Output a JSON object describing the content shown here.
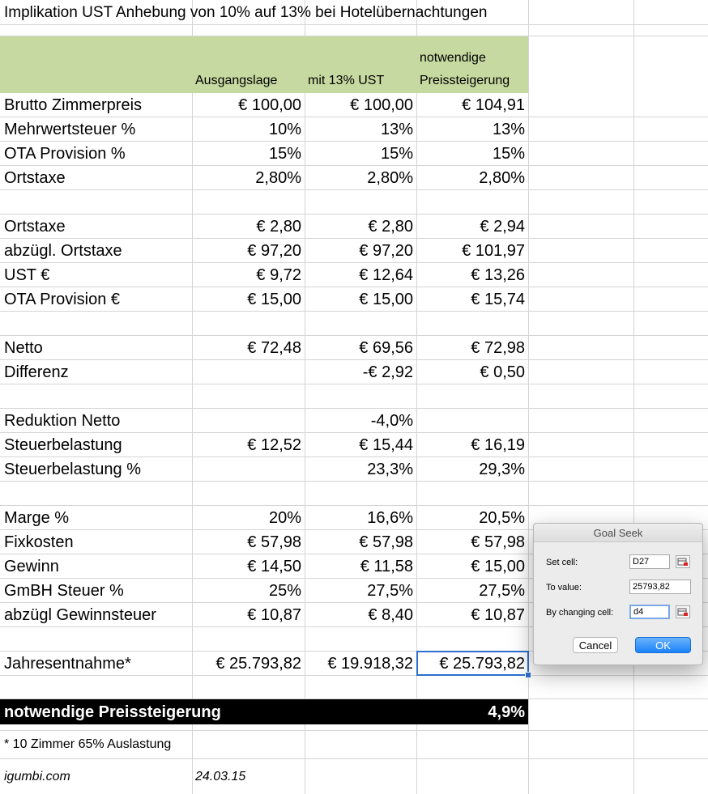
{
  "sheet": {
    "title": "Implikation UST Anhebung von 10% auf 13% bei Hotelübernachtungen",
    "headers": {
      "col_b": "Ausgangslage",
      "col_c": "mit 13% UST",
      "col_d_line1": "notwendige",
      "col_d_line2": "Preissteigerung"
    },
    "rows": [
      {
        "label": "Brutto Zimmerpreis",
        "b": "€ 100,00",
        "c": "€ 100,00",
        "d": "€ 104,91"
      },
      {
        "label": "Mehrwertsteuer %",
        "b": "10%",
        "c": "13%",
        "d": "13%"
      },
      {
        "label": "OTA Provision %",
        "b": "15%",
        "c": "15%",
        "d": "15%"
      },
      {
        "label": "Ortstaxe",
        "b": "2,80%",
        "c": "2,80%",
        "d": "2,80%"
      },
      {
        "label": "",
        "b": "",
        "c": "",
        "d": ""
      },
      {
        "label": "Ortstaxe",
        "b": "€ 2,80",
        "c": "€ 2,80",
        "d": "€ 2,94"
      },
      {
        "label": "abzügl. Ortstaxe",
        "b": "€ 97,20",
        "c": "€ 97,20",
        "d": "€ 101,97"
      },
      {
        "label": "UST €",
        "b": "€ 9,72",
        "c": "€ 12,64",
        "d": "€ 13,26"
      },
      {
        "label": "OTA Provision €",
        "b": "€ 15,00",
        "c": "€ 15,00",
        "d": "€ 15,74"
      },
      {
        "label": "",
        "b": "",
        "c": "",
        "d": ""
      },
      {
        "label": "Netto",
        "b": "€ 72,48",
        "c": "€ 69,56",
        "d": "€ 72,98"
      },
      {
        "label": "Differenz",
        "b": "",
        "c": "-€ 2,92",
        "d": "€ 0,50"
      },
      {
        "label": "",
        "b": "",
        "c": "",
        "d": ""
      },
      {
        "label": "Reduktion Netto",
        "b": "",
        "c": "-4,0%",
        "d": ""
      },
      {
        "label": "Steuerbelastung",
        "b": "€ 12,52",
        "c": "€ 15,44",
        "d": "€ 16,19"
      },
      {
        "label": "Steuerbelastung %",
        "b": "",
        "c": "23,3%",
        "d": "29,3%"
      },
      {
        "label": "",
        "b": "",
        "c": "",
        "d": ""
      },
      {
        "label": "Marge %",
        "b": "20%",
        "c": "16,6%",
        "d": "20,5%"
      },
      {
        "label": "Fixkosten",
        "b": "€ 57,98",
        "c": "€ 57,98",
        "d": "€ 57,98"
      },
      {
        "label": "Gewinn",
        "b": "€ 14,50",
        "c": "€ 11,58",
        "d": "€ 15,00"
      },
      {
        "label": "GmBH Steuer %",
        "b": "25%",
        "c": "27,5%",
        "d": "27,5%"
      },
      {
        "label": "abzügl Gewinnsteuer",
        "b": "€ 10,87",
        "c": "€ 8,40",
        "d": "€ 10,87"
      },
      {
        "label": "",
        "b": "",
        "c": "",
        "d": ""
      }
    ],
    "jahres": {
      "label": "Jahresentnahme*",
      "b": "€ 25.793,82",
      "c": "€ 19.918,32",
      "d": "€ 25.793,82"
    },
    "summary": {
      "label": "notwendige Preissteigerung",
      "value": "4,9%"
    },
    "footnote": "* 10 Zimmer 65% Auslastung",
    "site": "igumbi.com",
    "date": "24.03.15"
  },
  "goal_seek": {
    "title": "Goal Seek",
    "set_cell_label": "Set cell:",
    "set_cell_value": "D27",
    "to_value_label": "To value:",
    "to_value_value": "25793,82",
    "changing_cell_label": "By changing cell:",
    "changing_cell_value": "d4",
    "cancel_label": "Cancel",
    "ok_label": "OK"
  },
  "colors": {
    "header_fill": "#c6d9a0",
    "selection": "#2e6fce",
    "ok_button": "#1a82fb"
  }
}
